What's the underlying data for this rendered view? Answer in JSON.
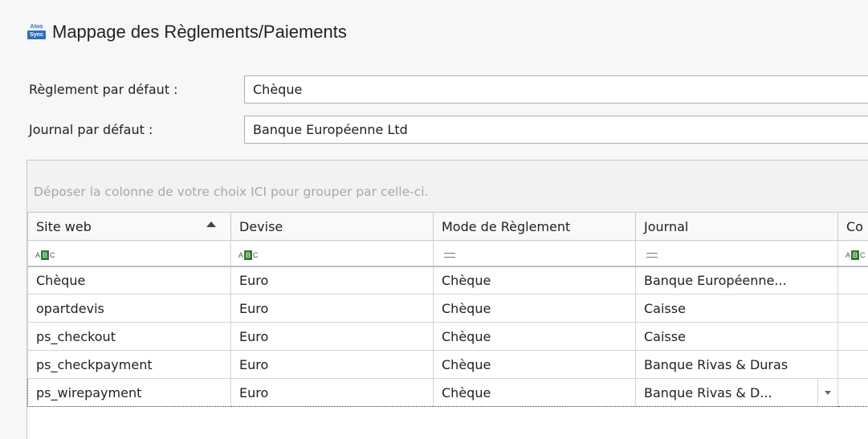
{
  "window": {
    "icon_top": "Atoo",
    "icon_bottom": "Sync",
    "title": "Mappage des Règlements/Paiements"
  },
  "form": {
    "reglement_label": "Règlement par défaut :",
    "reglement_value": "Chèque",
    "journal_label": "Journal par défaut :",
    "journal_value": "Banque Européenne Ltd"
  },
  "grid": {
    "group_panel_text": "Déposer la colonne de votre choix ICI pour grouper par celle-ci.",
    "columns": [
      "Site web",
      "Devise",
      "Mode de Règlement",
      "Journal",
      "Co"
    ],
    "sort_column": "Site web",
    "rows": [
      {
        "site": "Chèque",
        "devise": "Euro",
        "mode": "Chèque",
        "journal": "Banque Européenne..."
      },
      {
        "site": "opartdevis",
        "devise": "Euro",
        "mode": "Chèque",
        "journal": "Caisse"
      },
      {
        "site": "ps_checkout",
        "devise": "Euro",
        "mode": "Chèque",
        "journal": "Caisse"
      },
      {
        "site": "ps_checkpayment",
        "devise": "Euro",
        "mode": "Chèque",
        "journal": "Banque Rivas & Duras"
      },
      {
        "site": "ps_wirepayment",
        "devise": "Euro",
        "mode": "Chèque",
        "journal": "Banque Rivas & D..."
      }
    ]
  }
}
